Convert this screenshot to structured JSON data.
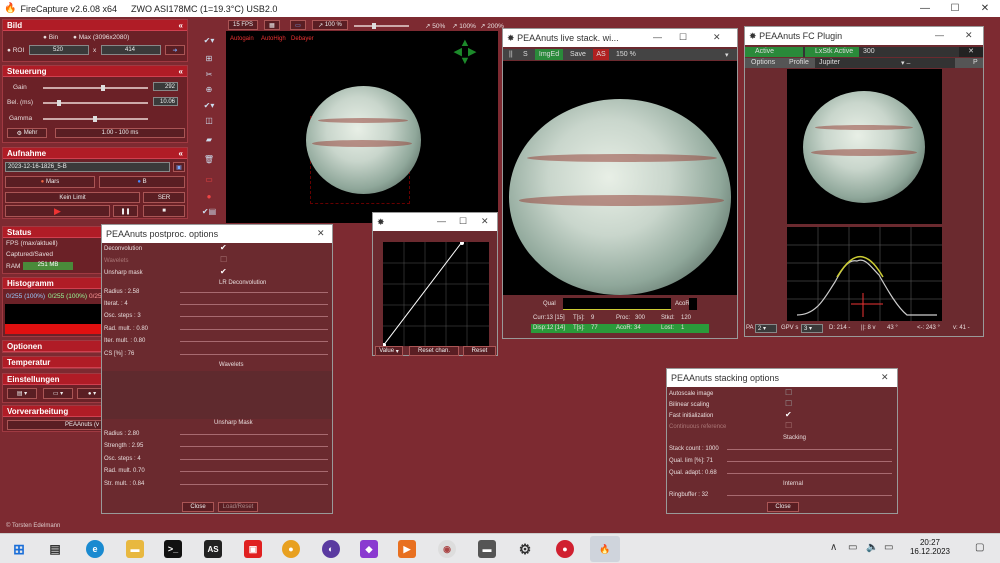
{
  "app": {
    "title": "FireCapture v2.6.08  x64",
    "camera": "ZWO ASI178MC (1=19.3°C) USB2.0"
  },
  "bild": {
    "title": "Bild",
    "bin": "Bin",
    "max": "Max (3096x2080)",
    "roi_label": "ROI",
    "roi_w": "520",
    "roi_x": "x",
    "roi_h": "414"
  },
  "steuerung": {
    "title": "Steuerung",
    "gain_label": "Gain",
    "gain_value": "292",
    "bel_label": "Bel. (ms)",
    "bel_value": "10.06",
    "gamma_label": "Gamma",
    "mehr": "Mehr",
    "range": "1.00 - 100 ms"
  },
  "aufnahme": {
    "title": "Aufnahme",
    "name": "2023-12-16-1826_5-B",
    "planet": "Mars",
    "filter": "B",
    "limit": "Kein Limit",
    "format": "SER"
  },
  "status": {
    "title": "Status",
    "fps": "FPS (max/aktuell)",
    "captured": "Captured/Saved",
    "ram_label": "RAM",
    "ram_value": "251 MB"
  },
  "histogramm": {
    "title": "Histogramm",
    "r": "0/255 (100%)",
    "g": "0/255 (100%)",
    "b": "0/255"
  },
  "sections": {
    "optionen": "Optionen",
    "temperatur": "Temperatur",
    "einstellungen": "Einstellungen",
    "vorverarbeitung": "Vorverarbeitung",
    "peaanuts": "PEAAnuts (v 1"
  },
  "footer": "© Torsten Edelmann",
  "topbar": {
    "fps": "15 FPS",
    "zoom": "100 %",
    "p50": "50%",
    "p100": "100%",
    "p200": "200%"
  },
  "preview": {
    "autogain": "Autogain",
    "autohigh": "AutoHigh",
    "debayer": "Debayer"
  },
  "postproc": {
    "title": "PEAAnuts postproc. options",
    "deconv": "Deconvolution",
    "wavelets": "Wavelets",
    "unsharp": "Unsharp mask",
    "lr": "LR Deconvolution",
    "radius": "Radius   : 2.58",
    "iterat": "Iterat.    : 4",
    "osc": "Osc. steps : 3",
    "radmult": "Rad. mult. : 0.80",
    "itermult": "Iter. mult. : 0.80",
    "cs": "CS [%]    : 76",
    "wav_title": "Wavelets",
    "us_title": "Unsharp Mask",
    "us_radius": "Radius    : 2.80",
    "strength": "Strength  : 2.95",
    "us_osc": "Osc. steps : 4",
    "us_radmult": "Rad. mult. 0.70",
    "strmult": "Str. mult.  : 0.84",
    "close": "Close",
    "reset": "Load/Reset"
  },
  "curve": {
    "value": "Value",
    "reset_chan": "Reset chan.",
    "reset": "Reset"
  },
  "live": {
    "title": "PEAAnuts live stack. wi...",
    "pause": "||",
    "s": "S",
    "imged": "ImgEd",
    "save": "Save",
    "as": "AS",
    "zoom": "150 %",
    "qual": "Qual",
    "acor": "AcoR",
    "curr": "Curr:13 [15]",
    "ts1": "T[s]:",
    "ts1v": "9",
    "proc": "Proc:",
    "procv": "300",
    "stkd": "Stkd:",
    "stkdv": "120",
    "disp": "Disp:12 [14]",
    "ts2": "T[s]:",
    "ts2v": "77",
    "acor2": "AcoR: 34",
    "lost": "Lost:",
    "lostv": "1"
  },
  "fc": {
    "title": "PEAAnuts FC Plugin",
    "active": "Active",
    "lxstk": "LxStk Active",
    "val": "300",
    "options": "Options",
    "profile": "Profile",
    "planet": "Jupiter",
    "pa": "PA",
    "pav": "2",
    "gpv": "GPV s",
    "gpvv": "3",
    "d": "D: 214 -",
    "ll": "||: 8 v",
    "deg1": "43 °",
    "deg2": "<-: 243 °",
    "v": "v: 41 -",
    "p": "P"
  },
  "stacking": {
    "title": "PEAAnuts stacking options",
    "autoscale": "Autoscale image",
    "bilinear": "Bilinear scaling",
    "fastinit": "Fast initialization",
    "continuous": "Continuous reference",
    "stacking": "Stacking",
    "stackcount": "Stack count  :  1000",
    "quallim": "Qual. lim [%]:  71",
    "qualadapt": "Qual. adapt.: 0.68",
    "internal": "Internal",
    "ringbuffer": "Ringbuffer  :  32",
    "close": "Close"
  },
  "taskbar": {
    "time": "20:27",
    "date": "16.12.2023"
  }
}
